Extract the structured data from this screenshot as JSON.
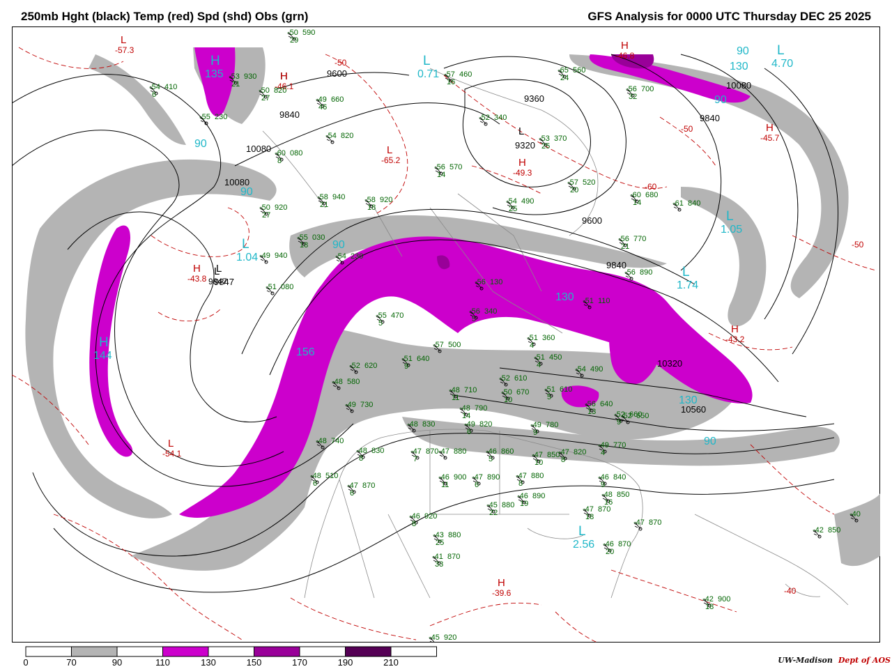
{
  "header": {
    "title_left": "250mb Hght (black) Temp (red) Spd (shd) Obs (grn)",
    "title_right": "GFS Analysis for 0000 UTC Thursday  DEC 25 2025"
  },
  "colors": {
    "height_contour": "#000000",
    "temperature_contour": "#c00000",
    "obs_text": "#006400",
    "speed_label": "#1fb7c8",
    "speed_70_90": "#b4b4b4",
    "speed_110_130": "#cc00cc",
    "speed_150_170": "#990099",
    "speed_190_210": "#550055",
    "background": "#ffffff"
  },
  "legend": {
    "ticks": [
      "0",
      "70",
      "90",
      "110",
      "130",
      "150",
      "170",
      "190",
      "210"
    ],
    "fills": [
      "#ffffff",
      "#b4b4b4",
      "#ffffff",
      "#cc00cc",
      "#ffffff",
      "#990099",
      "#ffffff",
      "#550055",
      "#ffffff"
    ]
  },
  "credit": {
    "org": "UW-Madison",
    "dept": "Dept of AOS"
  },
  "height_labels": [
    "9600",
    "9840",
    "10080",
    "10080",
    "9360",
    "9320",
    "9600",
    "9840",
    "9840",
    "10080",
    "10320",
    "10560",
    "9847"
  ],
  "centers": [
    {
      "type": "H",
      "value": "",
      "kind": "height"
    },
    {
      "type": "L",
      "value": "",
      "kind": "height"
    },
    {
      "type": "L",
      "value": "9847",
      "kind": "height"
    },
    {
      "type": "L",
      "value": "",
      "kind": "height"
    },
    {
      "type": "H",
      "value": "-43.8",
      "kind": "temp"
    },
    {
      "type": "H",
      "value": "-46.1",
      "kind": "temp"
    },
    {
      "type": "L",
      "value": "-65.2",
      "kind": "temp"
    },
    {
      "type": "H",
      "value": "-49.3",
      "kind": "temp"
    },
    {
      "type": "H",
      "value": "-46.8",
      "kind": "temp"
    },
    {
      "type": "H",
      "value": "-45.7",
      "kind": "temp"
    },
    {
      "type": "H",
      "value": "-43.2",
      "kind": "temp"
    },
    {
      "type": "L",
      "value": "-54.1",
      "kind": "temp"
    },
    {
      "type": "L",
      "value": "-57.3",
      "kind": "temp"
    },
    {
      "type": "H",
      "value": "-39.6",
      "kind": "temp"
    },
    {
      "type": "L",
      "value": "1.04",
      "kind": "speed"
    },
    {
      "type": "L",
      "value": "0.71",
      "kind": "speed"
    },
    {
      "type": "L",
      "value": "4.70",
      "kind": "speed"
    },
    {
      "type": "L",
      "value": "1.05",
      "kind": "speed"
    },
    {
      "type": "L",
      "value": "2.56",
      "kind": "speed"
    },
    {
      "type": "H",
      "value": "144",
      "kind": "speed"
    },
    {
      "type": "H",
      "value": "135",
      "kind": "speed"
    },
    {
      "type": "L",
      "value": "1.74",
      "kind": "speed"
    }
  ],
  "temp_labels": [
    "-50",
    "-50",
    "-60",
    "-40",
    "-50"
  ],
  "speed_labels": [
    "90",
    "90",
    "90",
    "90",
    "90",
    "130",
    "130",
    "156",
    "90",
    "130"
  ],
  "obs": [
    {
      "t": "-50",
      "h": "590",
      "d": "29"
    },
    {
      "t": "-54",
      "h": "410",
      "d": "6"
    },
    {
      "t": "-53",
      "h": "930",
      "d": "21"
    },
    {
      "t": "-50",
      "h": "820",
      "d": "27"
    },
    {
      "t": "-55",
      "h": "230",
      "d": ""
    },
    {
      "t": "-49",
      "h": "660",
      "d": "46"
    },
    {
      "t": "-54",
      "h": "820",
      "d": ""
    },
    {
      "t": "-60",
      "h": "080",
      "d": "8"
    },
    {
      "t": "-57",
      "h": "460",
      "d": "16"
    },
    {
      "t": "-52",
      "h": "340",
      "d": ""
    },
    {
      "t": "-53",
      "h": "370",
      "d": "25"
    },
    {
      "t": "-65",
      "h": "560",
      "d": "24"
    },
    {
      "t": "-56",
      "h": "700",
      "d": "32"
    },
    {
      "t": "-50",
      "h": "920",
      "d": "27"
    },
    {
      "t": "-58",
      "h": "940",
      "d": "21"
    },
    {
      "t": "-58",
      "h": "920",
      "d": "18"
    },
    {
      "t": "-56",
      "h": "570",
      "d": "14"
    },
    {
      "t": "-54",
      "h": "490",
      "d": "25"
    },
    {
      "t": "-57",
      "h": "520",
      "d": "20"
    },
    {
      "t": "-60",
      "h": "680",
      "d": "14"
    },
    {
      "t": "-61",
      "h": "840",
      "d": ""
    },
    {
      "t": "-55",
      "h": "030",
      "d": "18"
    },
    {
      "t": "-49",
      "h": "940",
      "d": ""
    },
    {
      "t": "-51",
      "h": "080",
      "d": ""
    },
    {
      "t": "-54",
      "h": "230",
      "d": ""
    },
    {
      "t": "-55",
      "h": "470",
      "d": "5"
    },
    {
      "t": "-56",
      "h": "130",
      "d": ""
    },
    {
      "t": "-56",
      "h": "340",
      "d": "5"
    },
    {
      "t": "-56",
      "h": "770",
      "d": "21"
    },
    {
      "t": "-56",
      "h": "890",
      "d": ""
    },
    {
      "t": "-51",
      "h": "110",
      "d": ""
    },
    {
      "t": "-52",
      "h": "620",
      "d": ""
    },
    {
      "t": "-51",
      "h": "640",
      "d": "9"
    },
    {
      "t": "-57",
      "h": "500",
      "d": ""
    },
    {
      "t": "-51",
      "h": "360",
      "d": "4"
    },
    {
      "t": "-51",
      "h": "450",
      "d": "4"
    },
    {
      "t": "-54",
      "h": "490",
      "d": ""
    },
    {
      "t": "-52",
      "h": "610",
      "d": ""
    },
    {
      "t": "-50",
      "h": "670",
      "d": "10"
    },
    {
      "t": "-51",
      "h": "610",
      "d": "5"
    },
    {
      "t": "-56",
      "h": "640",
      "d": "13"
    },
    {
      "t": "-52",
      "h": "660",
      "d": "9"
    },
    {
      "t": "-52",
      "h": "650",
      "d": ""
    },
    {
      "t": "-48",
      "h": "580",
      "d": ""
    },
    {
      "t": "-49",
      "h": "730",
      "d": ""
    },
    {
      "t": "-48",
      "h": "740",
      "d": ""
    },
    {
      "t": "-48",
      "h": "830",
      "d": "8"
    },
    {
      "t": "-47",
      "h": "870",
      "d": "7"
    },
    {
      "t": "-47",
      "h": "880",
      "d": ""
    },
    {
      "t": "-48",
      "h": "830",
      "d": ""
    },
    {
      "t": "-48",
      "h": "710",
      "d": "11"
    },
    {
      "t": "-48",
      "h": "790",
      "d": "14"
    },
    {
      "t": "-49",
      "h": "820",
      "d": "6"
    },
    {
      "t": "-49",
      "h": "780",
      "d": "9"
    },
    {
      "t": "-46",
      "h": "860",
      "d": "5"
    },
    {
      "t": "-47",
      "h": "850",
      "d": "10"
    },
    {
      "t": "-47",
      "h": "820",
      "d": "8"
    },
    {
      "t": "-49",
      "h": "770",
      "d": "4"
    },
    {
      "t": "-48",
      "h": "510",
      "d": "6"
    },
    {
      "t": "-47",
      "h": "870",
      "d": "6"
    },
    {
      "t": "-46",
      "h": "900",
      "d": "11"
    },
    {
      "t": "-47",
      "h": "890",
      "d": "6"
    },
    {
      "t": "-47",
      "h": "880",
      "d": "8"
    },
    {
      "t": "-46",
      "h": "890",
      "d": "19"
    },
    {
      "t": "-46",
      "h": "840",
      "d": "9"
    },
    {
      "t": "-48",
      "h": "850",
      "d": "16"
    },
    {
      "t": "-47",
      "h": "870",
      "d": "18"
    },
    {
      "t": "-47",
      "h": "870",
      "d": ""
    },
    {
      "t": "-46",
      "h": "870",
      "d": "20"
    },
    {
      "t": "-45",
      "h": "880",
      "d": "22"
    },
    {
      "t": "-46",
      "h": "920",
      "d": "8"
    },
    {
      "t": "-43",
      "h": "880",
      "d": "25"
    },
    {
      "t": "-41",
      "h": "870",
      "d": "33"
    },
    {
      "t": "-42",
      "h": "850",
      "d": ""
    },
    {
      "t": "-40",
      "h": "",
      "d": ""
    },
    {
      "t": "-42",
      "h": "900",
      "d": "18"
    },
    {
      "t": "-45",
      "h": "920",
      "d": ""
    }
  ]
}
